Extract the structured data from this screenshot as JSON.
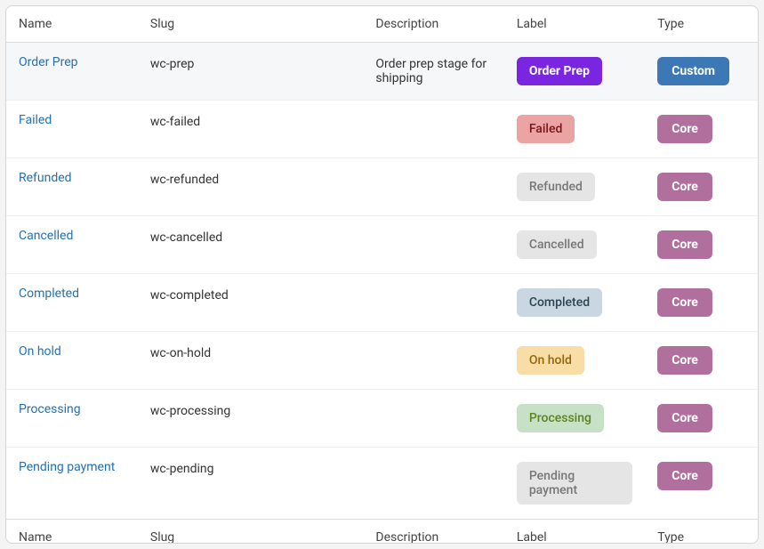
{
  "columns": {
    "name": "Name",
    "slug": "Slug",
    "description": "Description",
    "label": "Label",
    "type": "Type"
  },
  "colors": {
    "type_core": "#b16f9d",
    "type_custom": "#3b78b5"
  },
  "rows": [
    {
      "name": "Order Prep",
      "slug": "wc-prep",
      "description": "Order prep stage for shipping",
      "label": {
        "text": "Order Prep",
        "bg": "#7a25e0",
        "fg": "#ffffff",
        "bold": true
      },
      "type": "Custom"
    },
    {
      "name": "Failed",
      "slug": "wc-failed",
      "description": "",
      "label": {
        "text": "Failed",
        "bg": "#eba3a3",
        "fg": "#761919",
        "bold": false
      },
      "type": "Core"
    },
    {
      "name": "Refunded",
      "slug": "wc-refunded",
      "description": "",
      "label": {
        "text": "Refunded",
        "bg": "#e5e5e5",
        "fg": "#777777",
        "bold": false
      },
      "type": "Core"
    },
    {
      "name": "Cancelled",
      "slug": "wc-cancelled",
      "description": "",
      "label": {
        "text": "Cancelled",
        "bg": "#e5e5e5",
        "fg": "#777777",
        "bold": false
      },
      "type": "Core"
    },
    {
      "name": "Completed",
      "slug": "wc-completed",
      "description": "",
      "label": {
        "text": "Completed",
        "bg": "#c8d7e1",
        "fg": "#2e4453",
        "bold": false
      },
      "type": "Core"
    },
    {
      "name": "On hold",
      "slug": "wc-on-hold",
      "description": "",
      "label": {
        "text": "On hold",
        "bg": "#f8dda7",
        "fg": "#94660c",
        "bold": false
      },
      "type": "Core"
    },
    {
      "name": "Processing",
      "slug": "wc-processing",
      "description": "",
      "label": {
        "text": "Processing",
        "bg": "#c6e1c6",
        "fg": "#5b841b",
        "bold": false
      },
      "type": "Core"
    },
    {
      "name": "Pending payment",
      "slug": "wc-pending",
      "description": "",
      "label": {
        "text": "Pending payment",
        "bg": "#e5e5e5",
        "fg": "#777777",
        "bold": false
      },
      "type": "Core"
    }
  ]
}
